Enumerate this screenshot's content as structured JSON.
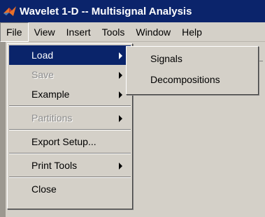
{
  "window": {
    "title": "Wavelet 1-D -- Multisignal Analysis",
    "icon": "matlab-logo-icon"
  },
  "menubar": [
    "File",
    "View",
    "Insert",
    "Tools",
    "Window",
    "Help"
  ],
  "file_menu": {
    "items": [
      {
        "label": "Load",
        "submenu": true,
        "enabled": true,
        "selected": true
      },
      {
        "label": "Save",
        "submenu": true,
        "enabled": false
      },
      {
        "label": "Example",
        "submenu": true,
        "enabled": true
      },
      {
        "label": "Partitions",
        "submenu": true,
        "enabled": false
      },
      {
        "label": "Export Setup...",
        "submenu": false,
        "enabled": true
      },
      {
        "label": "Print Tools",
        "submenu": true,
        "enabled": true
      },
      {
        "label": "Close",
        "submenu": false,
        "enabled": true
      }
    ]
  },
  "load_submenu": {
    "items": [
      "Signals",
      "Decompositions"
    ]
  },
  "background_hint": "e",
  "colors": {
    "title_bar": "#0b246b",
    "selection": "#0a246a",
    "face": "#d4d0c8"
  }
}
